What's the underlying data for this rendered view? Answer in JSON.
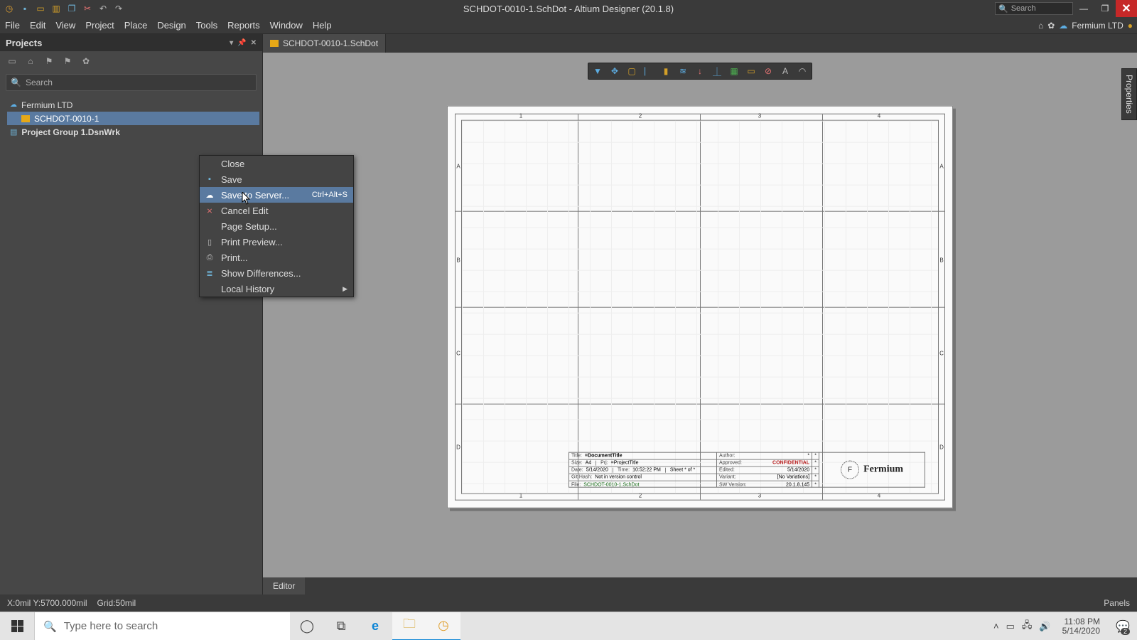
{
  "titlebar": {
    "title": "SCHDOT-0010-1.SchDot - Altium Designer (20.1.8)",
    "search_placeholder": "Search"
  },
  "menubar": {
    "items": [
      "File",
      "Edit",
      "View",
      "Project",
      "Place",
      "Design",
      "Tools",
      "Reports",
      "Window",
      "Help"
    ],
    "org": "Fermium LTD"
  },
  "projects": {
    "title": "Projects",
    "search_placeholder": "Search",
    "tree": {
      "root": "Fermium LTD",
      "item": "SCHDOT-0010-1",
      "group": "Project Group 1.DsnWrk"
    }
  },
  "doctab": {
    "label": "SCHDOT-0010-1.SchDot"
  },
  "context_menu": {
    "items": [
      {
        "label": "Close",
        "icon": ""
      },
      {
        "label": "Save",
        "icon": "save"
      },
      {
        "label": "Save to Server...",
        "icon": "cloud",
        "accel": "Ctrl+Alt+S",
        "hover": true
      },
      {
        "label": "Cancel Edit",
        "icon": "cancel"
      },
      {
        "label": "Page Setup...",
        "icon": ""
      },
      {
        "label": "Print Preview...",
        "icon": "page"
      },
      {
        "label": "Print...",
        "icon": "printer"
      },
      {
        "label": "Show Differences...",
        "icon": "diff"
      },
      {
        "label": "Local History",
        "icon": "",
        "submenu": true
      }
    ]
  },
  "sheet": {
    "cols": [
      "1",
      "2",
      "3",
      "4"
    ],
    "rows": [
      "A",
      "B",
      "C",
      "D"
    ],
    "titleblock": {
      "title_label": "Title:",
      "title_value": "=DocumentTitle",
      "size_label": "Size:",
      "size_value": "A4",
      "prj_label": "Prj:",
      "prj_value": "=ProjectTitle",
      "date_label": "Date:",
      "date_value": "5/14/2020",
      "time_label": "Time:",
      "time_value": "10:52:22 PM",
      "sheet_label": "Sheet *  of *",
      "githash_label": "Git Hash:",
      "githash_value": "Not in version control",
      "file_label": "File:",
      "file_value": "SCHDOT-0010-1.SchDot",
      "author_label": "Author:",
      "author_value": "*",
      "approved_label": "Approved:",
      "approved_value": "*",
      "confidential": "CONFIDENTIAL",
      "edited_label": "Edited:",
      "edited_value": "5/14/2020",
      "variant_label": "Variant:",
      "variant_value": "[No Variations]",
      "swver_label": "SW Version:",
      "swver_value": "20.1.8.145",
      "logo_text": "Fermium",
      "logo_letter": "F"
    }
  },
  "editor_tab": "Editor",
  "properties_tab": "Properties",
  "statusbar": {
    "coords": "X:0mil Y:5700.000mil",
    "grid": "Grid:50mil",
    "panels": "Panels"
  },
  "taskbar": {
    "search_placeholder": "Type here to search",
    "time": "11:08 PM",
    "date": "5/14/2020",
    "notif_count": "2"
  }
}
